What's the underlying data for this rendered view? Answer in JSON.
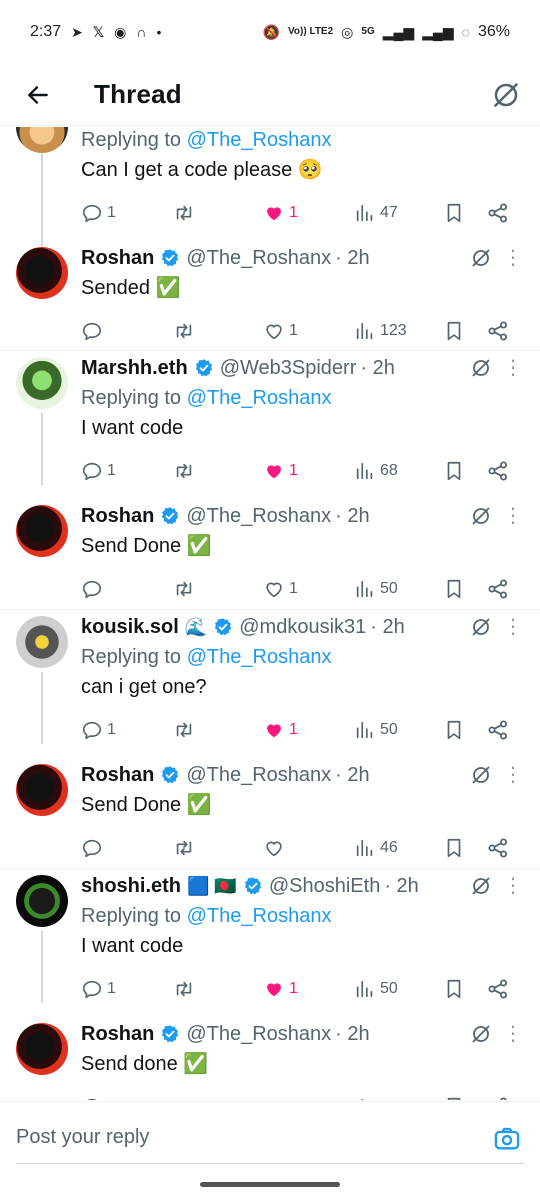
{
  "status_bar": {
    "time": "2:37",
    "network_label": "Vo)) LTE2",
    "signal_label": "5G",
    "battery": "36%"
  },
  "header": {
    "title": "Thread"
  },
  "replying_prefix": "Replying to",
  "tweets": [
    {
      "name": "",
      "handle": "",
      "time": "",
      "replying_to": "@The_Roshanx",
      "text": "Can I get a code please 🥺",
      "replies": "1",
      "reposts": "",
      "likes": "1",
      "liked": true,
      "views": "47"
    },
    {
      "name": "Roshan",
      "handle": "@The_Roshanx",
      "time": "· 2h",
      "replying_to": "",
      "text": "Sended ✅",
      "replies": "",
      "reposts": "",
      "likes": "1",
      "liked": false,
      "views": "123"
    },
    {
      "name": "Marshh.eth",
      "handle": "@Web3Spiderr",
      "time": "· 2h",
      "replying_to": "@The_Roshanx",
      "text": "I want code",
      "replies": "1",
      "reposts": "",
      "likes": "1",
      "liked": true,
      "views": "68"
    },
    {
      "name": "Roshan",
      "handle": "@The_Roshanx",
      "time": "· 2h",
      "replying_to": "",
      "text": "Send Done ✅",
      "replies": "",
      "reposts": "",
      "likes": "1",
      "liked": false,
      "views": "50"
    },
    {
      "name": "kousik.sol",
      "name_emoji": "🌊",
      "handle": "@mdkousik31",
      "time": "· 2h",
      "replying_to": "@The_Roshanx",
      "text": "can i get one?",
      "replies": "1",
      "reposts": "",
      "likes": "1",
      "liked": true,
      "views": "50"
    },
    {
      "name": "Roshan",
      "handle": "@The_Roshanx",
      "time": "· 2h",
      "replying_to": "",
      "text": "Send Done ✅",
      "replies": "",
      "reposts": "",
      "likes": "",
      "liked": false,
      "views": "46"
    },
    {
      "name": "shoshi.eth",
      "name_emoji": "🟦 🇧🇩",
      "handle": "@ShoshiEth",
      "time": "· 2h",
      "replying_to": "@The_Roshanx",
      "text": "I want code",
      "replies": "1",
      "reposts": "",
      "likes": "1",
      "liked": true,
      "views": "50"
    },
    {
      "name": "Roshan",
      "handle": "@The_Roshanx",
      "time": "· 2h",
      "replying_to": "",
      "text": "Send done ✅",
      "replies": "",
      "reposts": "",
      "likes": "",
      "liked": false,
      "views": ""
    }
  ],
  "reply_bar": {
    "placeholder": "Post your reply"
  },
  "colors": {
    "accent": "#1d9bf0",
    "like": "#f91880",
    "secondary_text": "#536471",
    "verified": "#1d9bf0"
  }
}
